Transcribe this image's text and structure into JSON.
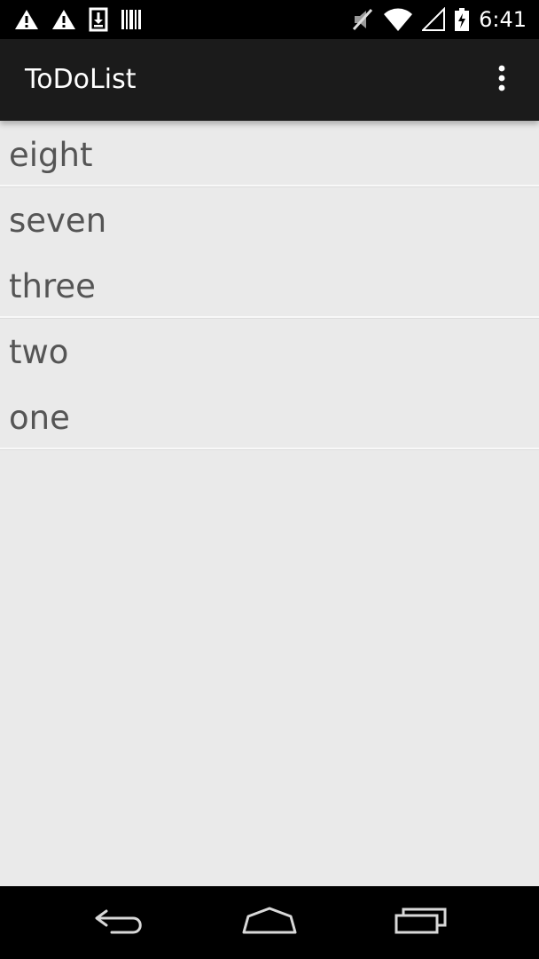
{
  "status_bar": {
    "time": "6:41",
    "icons_left": [
      "warning-icon",
      "warning-icon",
      "download-icon",
      "barcode-icon"
    ],
    "icons_right": [
      "muted-icon",
      "wifi-icon",
      "signal-icon",
      "battery-charging-icon"
    ]
  },
  "action_bar": {
    "title": "ToDoList",
    "overflow_icon": "overflow-menu-icon"
  },
  "list": {
    "items": [
      {
        "label": "eight"
      },
      {
        "label": "seven"
      },
      {
        "label": "three"
      },
      {
        "label": "two"
      },
      {
        "label": "one"
      }
    ]
  },
  "nav_bar": {
    "icons": [
      "back-icon",
      "home-icon",
      "recents-icon"
    ]
  },
  "colors": {
    "background": "#eaeaea",
    "action_bar": "#1b1b1b",
    "status_bar": "#000000",
    "item_text": "#555555"
  }
}
